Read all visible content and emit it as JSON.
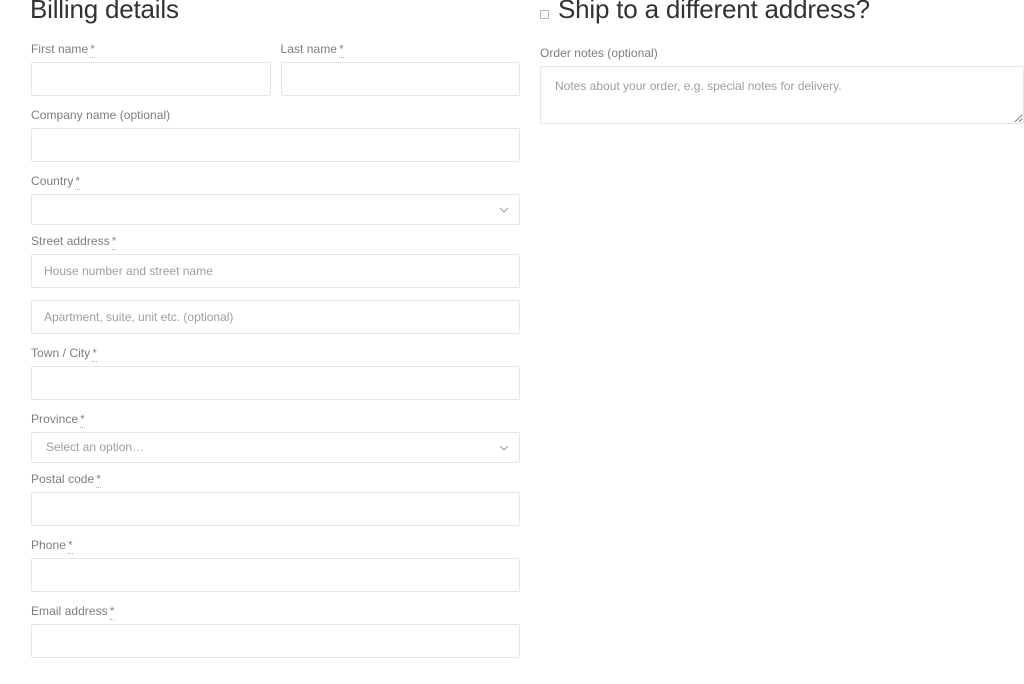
{
  "billing": {
    "heading": "Billing details",
    "fields": {
      "first_name": {
        "label": "First name",
        "required_mark": "*",
        "value": "",
        "placeholder": ""
      },
      "last_name": {
        "label": "Last name",
        "required_mark": "*",
        "value": "",
        "placeholder": ""
      },
      "company": {
        "label": "Company name (optional)",
        "value": "",
        "placeholder": ""
      },
      "country": {
        "label": "Country",
        "required_mark": "*",
        "selected": "",
        "placeholder": ""
      },
      "street_address": {
        "label": "Street address",
        "required_mark": "*"
      },
      "address_line1": {
        "value": "",
        "placeholder": "House number and street name"
      },
      "address_line2": {
        "value": "",
        "placeholder": "Apartment, suite, unit etc. (optional)"
      },
      "city": {
        "label": "Town / City",
        "required_mark": "*",
        "value": "",
        "placeholder": ""
      },
      "province": {
        "label": "Province",
        "required_mark": "*",
        "selected": "Select an option…"
      },
      "postal_code": {
        "label": "Postal code",
        "required_mark": "*",
        "value": "",
        "placeholder": ""
      },
      "phone": {
        "label": "Phone",
        "required_mark": "*",
        "value": "",
        "placeholder": ""
      },
      "email": {
        "label": "Email address",
        "required_mark": "*",
        "value": "",
        "placeholder": ""
      }
    }
  },
  "shipping": {
    "heading": "Ship to a different address?",
    "checkbox_checked": false,
    "notes": {
      "label": "Order notes (optional)",
      "value": "",
      "placeholder": "Notes about your order, e.g. special notes for delivery."
    }
  },
  "icons": {
    "chevron_down": "chevron-down-icon",
    "checkbox": "checkbox-icon"
  },
  "colors": {
    "heading_text": "#333333",
    "label_text": "#7d7d7d",
    "placeholder_text": "#9e9e9e",
    "field_border": "#e6e6e6",
    "background": "#ffffff"
  }
}
